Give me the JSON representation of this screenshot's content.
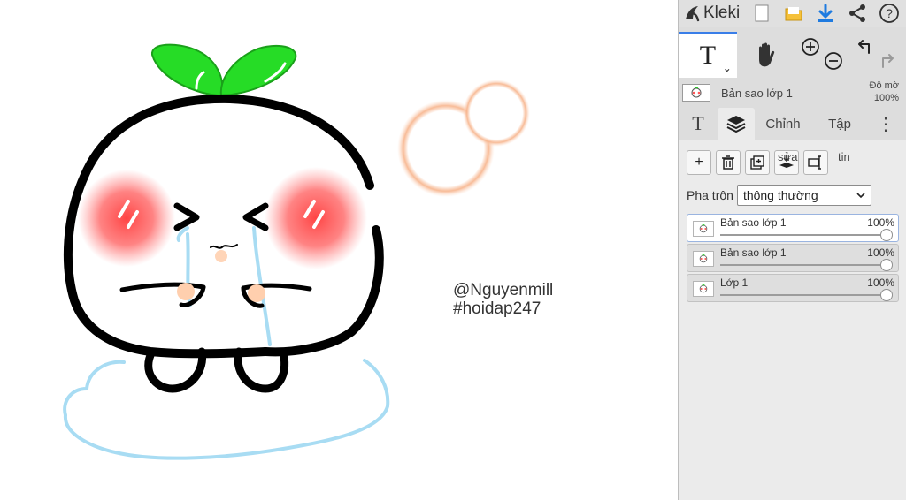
{
  "canvas": {
    "watermark_line1": "@Nguyenmill",
    "watermark_line2": "#hoidap247"
  },
  "app": {
    "name": "Kleki",
    "accent_color": "#3a7ee8"
  },
  "toolbar": {
    "icons": [
      "new-image-icon",
      "open-folder-icon",
      "download-icon",
      "share-icon",
      "help-icon"
    ],
    "help_label": "?"
  },
  "tools": {
    "text_tool_label": "T",
    "caret": "⌄"
  },
  "current_layer": {
    "name": "Bản sao lớp 1",
    "opacity_label": "Độ mờ",
    "opacity_value": "100%"
  },
  "tabs": {
    "text_label": "T",
    "edit_label": "Chỉnh",
    "file_label": "Tập",
    "more_label": "⋮"
  },
  "layer_actions": {
    "add": "+",
    "edit_label": "sửa",
    "info_label": "tin"
  },
  "blend": {
    "label": "Pha trộn",
    "value": "thông thường"
  },
  "layers": [
    {
      "name": "Bản sao lớp 1",
      "opacity": "100%",
      "opacity_level": 1.0,
      "active": true
    },
    {
      "name": "Bản sao lớp 1",
      "opacity": "100%",
      "opacity_level": 1.0,
      "active": false
    },
    {
      "name": "Lớp 1",
      "opacity": "100%",
      "opacity_level": 1.0,
      "active": false
    }
  ]
}
